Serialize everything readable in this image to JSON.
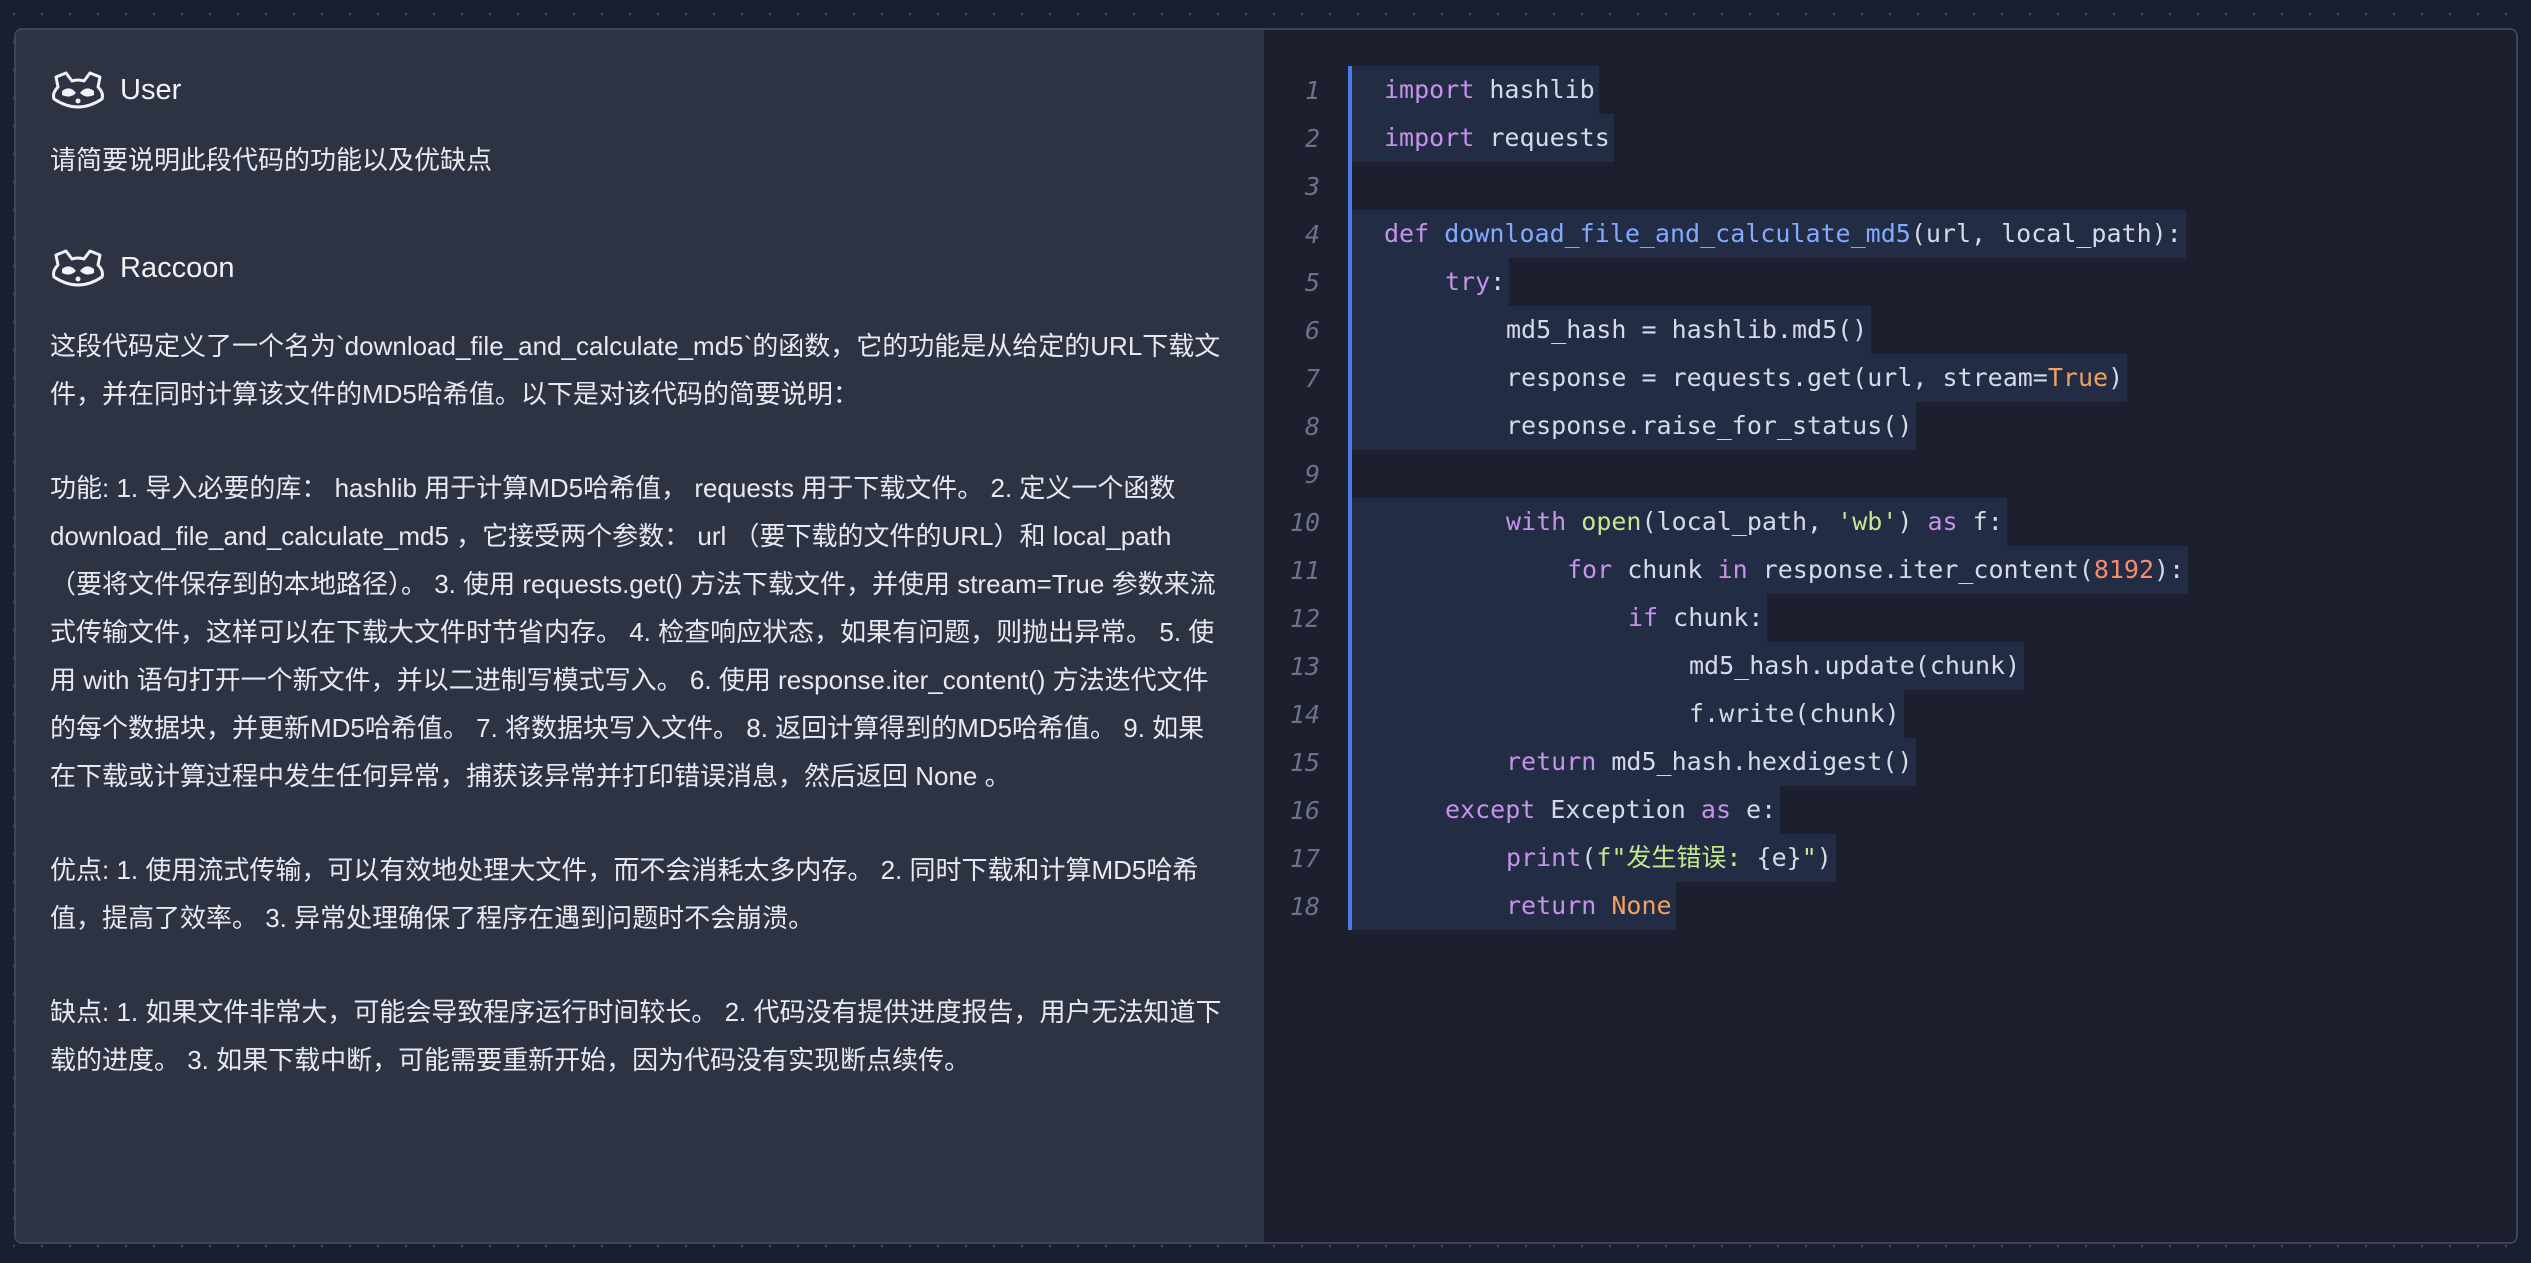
{
  "conversation": {
    "user": {
      "name": "User",
      "icon": "raccoon-icon",
      "message": "请简要说明此段代码的功能以及优缺点"
    },
    "assistant": {
      "name": "Raccoon",
      "icon": "raccoon-icon",
      "paragraphs": [
        "这段代码定义了一个名为`download_file_and_calculate_md5`的函数，它的功能是从给定的URL下载文件，并在同时计算该文件的MD5哈希值。以下是对该代码的简要说明：",
        "功能: 1. 导入必要的库： hashlib 用于计算MD5哈希值， requests 用于下载文件。 2. 定义一个函数 download_file_and_calculate_md5 ，它接受两个参数： url （要下载的文件的URL）和 local_path （要将文件保存到的本地路径）。 3. 使用 requests.get() 方法下载文件，并使用 stream=True 参数来流式传输文件，这样可以在下载大文件时节省内存。 4. 检查响应状态，如果有问题，则抛出异常。 5. 使用 with 语句打开一个新文件，并以二进制写模式写入。 6. 使用 response.iter_content() 方法迭代文件的每个数据块，并更新MD5哈希值。 7. 将数据块写入文件。 8. 返回计算得到的MD5哈希值。 9. 如果在下载或计算过程中发生任何异常，捕获该异常并打印错误消息，然后返回 None 。",
        "优点: 1. 使用流式传输，可以有效地处理大文件，而不会消耗太多内存。 2. 同时下载和计算MD5哈希值，提高了效率。 3. 异常处理确保了程序在遇到问题时不会崩溃。",
        "缺点: 1. 如果文件非常大，可能会导致程序运行时间较长。 2. 代码没有提供进度报告，用户无法知道下载的进度。 3. 如果下载中断，可能需要重新开始，因为代码没有实现断点续传。"
      ]
    }
  },
  "code_editor": {
    "accent_color": "#4b7ae8",
    "lines": [
      {
        "num": "1",
        "indent": 0,
        "tokens": [
          [
            "kw",
            "import"
          ],
          [
            "",
            "hashlib"
          ]
        ]
      },
      {
        "num": "2",
        "indent": 0,
        "tokens": [
          [
            "kw",
            "import"
          ],
          [
            "",
            "requests"
          ]
        ]
      },
      {
        "num": "3",
        "indent": 0,
        "tokens": []
      },
      {
        "num": "4",
        "indent": 0,
        "tokens": [
          [
            "kw",
            "def"
          ],
          [
            "fn",
            "download_file_and_calculate_md5"
          ],
          [
            "",
            "(url, local_path):"
          ]
        ]
      },
      {
        "num": "5",
        "indent": 1,
        "tokens": [
          [
            "kw",
            "try"
          ],
          [
            "",
            ":"
          ]
        ]
      },
      {
        "num": "6",
        "indent": 2,
        "tokens": [
          [
            "",
            "md5_hash = hashlib.md5()"
          ]
        ]
      },
      {
        "num": "7",
        "indent": 2,
        "tokens": [
          [
            "",
            "response = requests.get(url, stream="
          ],
          [
            "const",
            "True"
          ],
          [
            "",
            ")"
          ]
        ]
      },
      {
        "num": "8",
        "indent": 2,
        "tokens": [
          [
            "",
            "response.raise_for_status()"
          ]
        ]
      },
      {
        "num": "9",
        "indent": 0,
        "tokens": []
      },
      {
        "num": "10",
        "indent": 2,
        "tokens": [
          [
            "kw",
            "with"
          ],
          [
            "bi",
            "open"
          ],
          [
            "",
            "(local_path, "
          ],
          [
            "str",
            "'wb'"
          ],
          [
            "",
            ") "
          ],
          [
            "kw",
            "as"
          ],
          [
            "",
            " f:"
          ]
        ]
      },
      {
        "num": "11",
        "indent": 3,
        "tokens": [
          [
            "kw",
            "for"
          ],
          [
            "",
            " chunk "
          ],
          [
            "kw",
            "in"
          ],
          [
            "",
            " response.iter_content("
          ],
          [
            "num",
            "8192"
          ],
          [
            "",
            "):"
          ]
        ]
      },
      {
        "num": "12",
        "indent": 4,
        "tokens": [
          [
            "kw",
            "if"
          ],
          [
            "",
            " chunk:"
          ]
        ]
      },
      {
        "num": "13",
        "indent": 5,
        "tokens": [
          [
            "",
            "md5_hash.update(chunk)"
          ]
        ]
      },
      {
        "num": "14",
        "indent": 5,
        "tokens": [
          [
            "",
            "f.write(chunk)"
          ]
        ]
      },
      {
        "num": "15",
        "indent": 2,
        "tokens": [
          [
            "kw",
            "return"
          ],
          [
            "",
            " md5_hash.hexdigest()"
          ]
        ]
      },
      {
        "num": "16",
        "indent": 1,
        "tokens": [
          [
            "kw",
            "except"
          ],
          [
            "",
            " Exception "
          ],
          [
            "kw",
            "as"
          ],
          [
            "",
            " e:"
          ]
        ]
      },
      {
        "num": "17",
        "indent": 2,
        "tokens": [
          [
            "kw",
            "print"
          ],
          [
            "",
            "("
          ],
          [
            "str",
            "f\"发生错误: "
          ],
          [
            "",
            "{e}"
          ],
          [
            "str",
            "\""
          ],
          [
            "",
            ")"
          ]
        ]
      },
      {
        "num": "18",
        "indent": 2,
        "tokens": [
          [
            "kw",
            "return"
          ],
          [
            "const",
            " None"
          ]
        ]
      }
    ]
  }
}
